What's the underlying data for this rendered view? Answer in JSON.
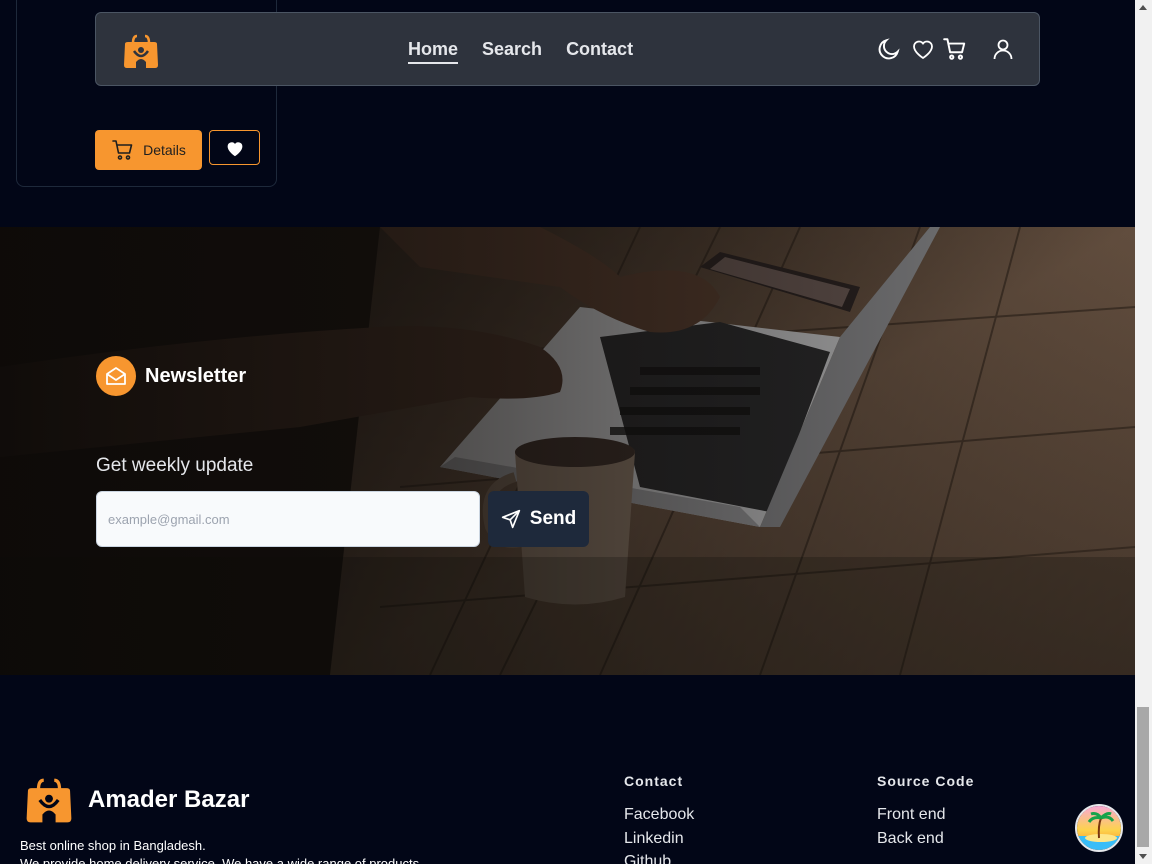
{
  "navbar": {
    "links": [
      {
        "label": "Home",
        "active": true
      },
      {
        "label": "Search",
        "active": false
      },
      {
        "label": "Contact",
        "active": false
      }
    ],
    "icons": [
      "moon-icon",
      "heart-icon",
      "cart-icon",
      "user-icon"
    ]
  },
  "product_card": {
    "details_label": "Details"
  },
  "newsletter": {
    "title": "Newsletter",
    "subtitle": "Get weekly update",
    "input_placeholder": "example@gmail.com",
    "send_label": "Send"
  },
  "footer": {
    "brand": "Amader Bazar",
    "desc_line1": "Best online shop in Bangladesh.",
    "desc_line2": "We provide home delivery service. We have a wide range of products.",
    "contact": {
      "heading": "Contact",
      "links": [
        "Facebook",
        "Linkedin",
        "Github"
      ]
    },
    "source": {
      "heading": "Source Code",
      "links": [
        "Front end",
        "Back end"
      ]
    }
  },
  "colors": {
    "accent": "#f7962f",
    "background": "#020617",
    "navbar": "#2e333d",
    "send_button": "#1e293b"
  }
}
